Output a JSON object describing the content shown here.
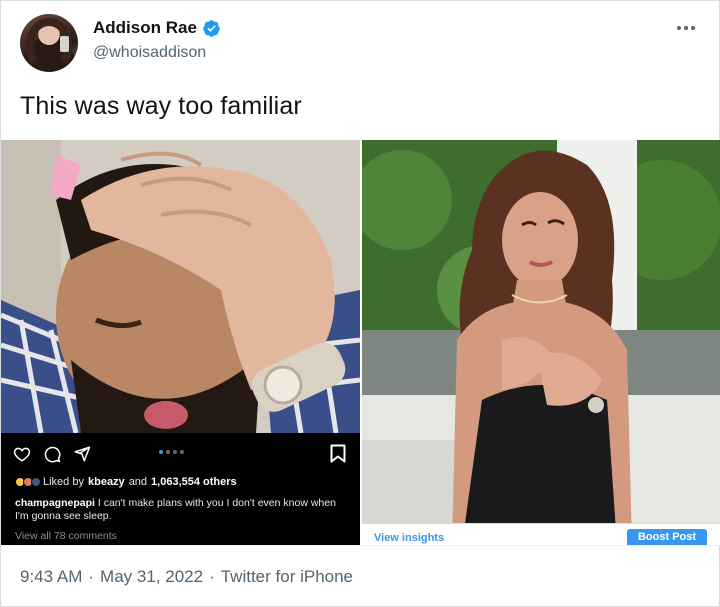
{
  "author": {
    "display_name": "Addison Rae",
    "handle": "@whoisaddison",
    "verified": true
  },
  "tweet": {
    "text": "This was way too familiar"
  },
  "meta": {
    "time": "9:43 AM",
    "separator1": "·",
    "date": "May 31, 2022",
    "separator2": "·",
    "source": "Twitter for iPhone"
  },
  "instagram": {
    "likes_prefix": "Liked by",
    "liked_by": "kbeazy",
    "likes_mid": "and",
    "likes_count": "1,063,554 others",
    "caption_user": "champagnepapi",
    "caption_text": "I can't make plans with you I don't even know when I'm gonna see sleep.",
    "comments": "View all 78 comments"
  },
  "right_post": {
    "insights_label": "View insights",
    "boost_label": "Boost Post"
  },
  "colors": {
    "verified_blue": "#1d9bf0",
    "ig_blue": "#3897f0",
    "secondary_text": "#536471"
  }
}
